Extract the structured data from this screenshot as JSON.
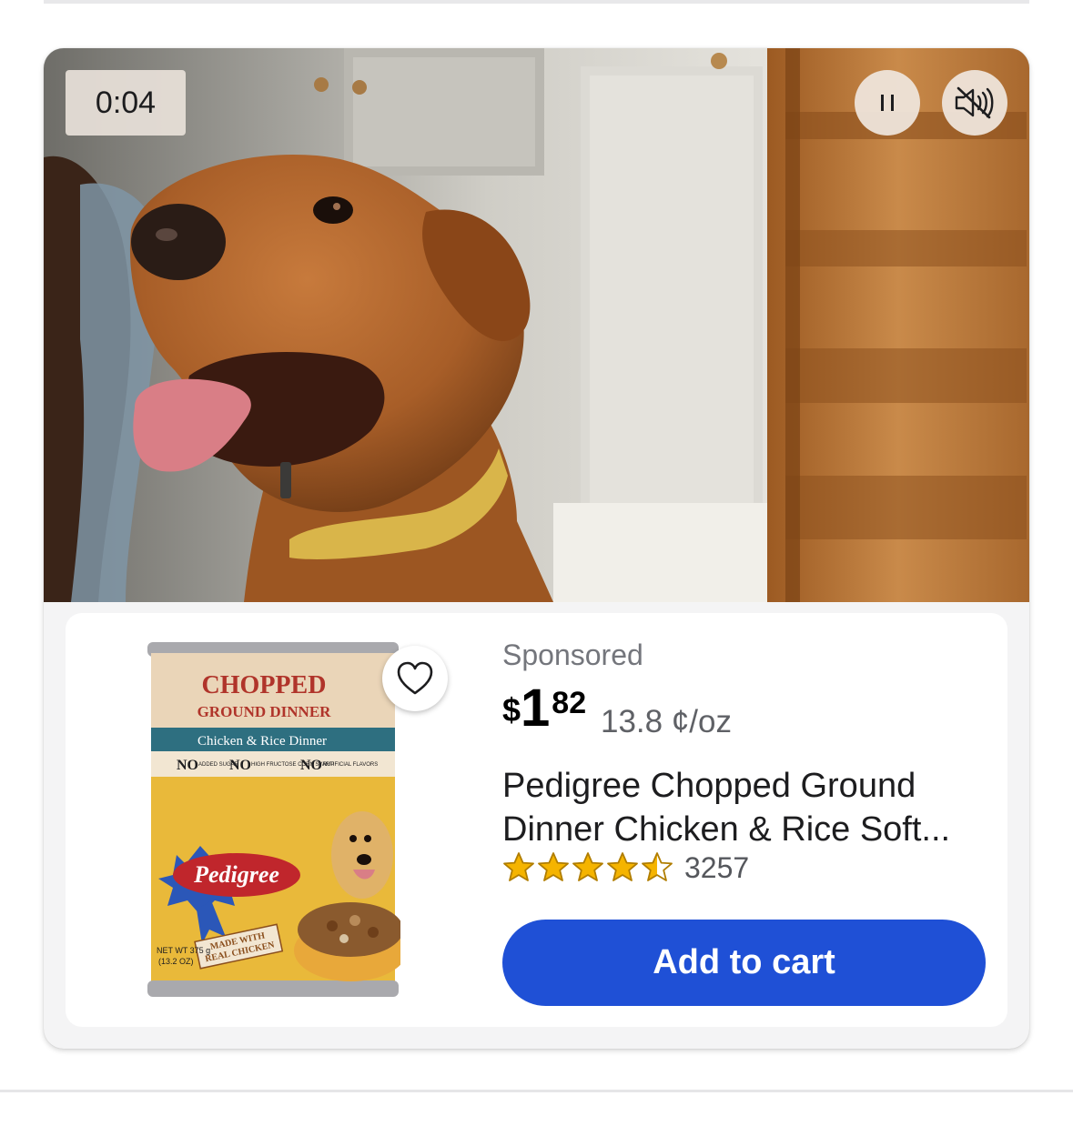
{
  "video": {
    "timestamp": "0:04",
    "controls": {
      "pause_icon": "pause-icon",
      "mute_icon": "muted-speaker-icon"
    }
  },
  "product": {
    "sponsored_label": "Sponsored",
    "price": {
      "currency": "$",
      "dollars": "1",
      "cents": "82"
    },
    "unit_price": "13.8 ¢/oz",
    "title_line1": "Pedigree Chopped Ground",
    "title_line2": "Dinner Chicken & Rice Soft...",
    "rating": 4.5,
    "review_count": "3257",
    "add_to_cart_label": "Add to cart",
    "favorite_icon": "heart-outline-icon",
    "image": {
      "headline": "CHOPPED",
      "subhead": "GROUND DINNER",
      "flavor": "Chicken & Rice Dinner",
      "claims": [
        "NO",
        "ADDED SUGAR",
        "NO",
        "HIGH FRUCTOSE CORN SYRUP",
        "NO",
        "ARTIFICIAL FLAVORS"
      ],
      "brand": "Pedigree",
      "badge_line1": "MADE WITH",
      "badge_line2": "REAL CHICKEN",
      "net_wt_line1": "NET WT 375 g",
      "net_wt_line2": "(13.2 OZ)"
    }
  },
  "colors": {
    "accent_button": "#1f50d6",
    "star_fill": "#f5b400",
    "card_bg": "#f4f4f5"
  }
}
